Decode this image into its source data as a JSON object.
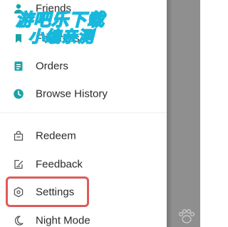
{
  "menu": {
    "items": [
      {
        "label": "Friends",
        "icon": "friends-icon"
      },
      {
        "label": "Favorites",
        "icon": "favorites-icon"
      },
      {
        "label": "Orders",
        "icon": "orders-icon"
      },
      {
        "label": "Browse History",
        "icon": "clock-icon"
      },
      {
        "label": "Redeem",
        "icon": "gift-bag-icon"
      },
      {
        "label": "Feedback",
        "icon": "edit-note-icon"
      },
      {
        "label": "Settings",
        "icon": "gear-hexagon-icon"
      },
      {
        "label": "Night Mode",
        "icon": "crescent-moon-icon"
      }
    ]
  },
  "watermark": {
    "line1": "游吧乐下载",
    "line2": "小编亲测"
  },
  "colors": {
    "icon_accent": "#1aa3a6",
    "icon_muted": "#555555",
    "highlight_border": "#df5a5a",
    "watermark_stroke": "#17b8dc",
    "overlay": "#8f8f8f"
  }
}
